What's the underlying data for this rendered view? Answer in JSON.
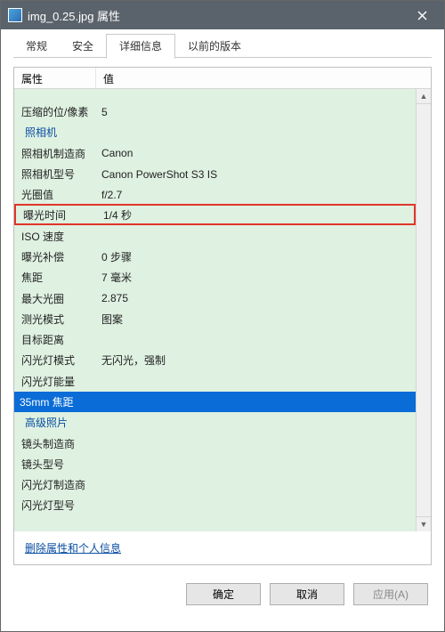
{
  "titlebar": {
    "title": "img_0.25.jpg 属性"
  },
  "tabs": [
    {
      "label": "常规"
    },
    {
      "label": "安全"
    },
    {
      "label": "详细信息",
      "active": true
    },
    {
      "label": "以前的版本"
    }
  ],
  "columns": {
    "property": "属性",
    "value": "值"
  },
  "rows": [
    {
      "type": "partial",
      "label": "",
      "value": ""
    },
    {
      "type": "data",
      "label": "压缩的位/像素",
      "value": "5"
    },
    {
      "type": "section",
      "label": "照相机",
      "value": ""
    },
    {
      "type": "data",
      "label": "照相机制造商",
      "value": "Canon"
    },
    {
      "type": "data",
      "label": "照相机型号",
      "value": "Canon PowerShot S3 IS"
    },
    {
      "type": "data",
      "label": "光圈值",
      "value": "f/2.7"
    },
    {
      "type": "hl-red",
      "label": "曝光时间",
      "value": "1/4 秒"
    },
    {
      "type": "data",
      "label": "ISO 速度",
      "value": ""
    },
    {
      "type": "data",
      "label": "曝光补偿",
      "value": "0 步骤"
    },
    {
      "type": "data",
      "label": "焦距",
      "value": "7 毫米"
    },
    {
      "type": "data",
      "label": "最大光圈",
      "value": "2.875"
    },
    {
      "type": "data",
      "label": "测光模式",
      "value": "图案"
    },
    {
      "type": "data",
      "label": "目标距离",
      "value": ""
    },
    {
      "type": "data",
      "label": "闪光灯模式",
      "value": "无闪光，强制"
    },
    {
      "type": "data",
      "label": "闪光灯能量",
      "value": ""
    },
    {
      "type": "selected",
      "label": "35mm 焦距",
      "value": ""
    },
    {
      "type": "section",
      "label": "高级照片",
      "value": ""
    },
    {
      "type": "data",
      "label": "镜头制造商",
      "value": ""
    },
    {
      "type": "data",
      "label": "镜头型号",
      "value": ""
    },
    {
      "type": "data",
      "label": "闪光灯制造商",
      "value": ""
    },
    {
      "type": "data",
      "label": "闪光灯型号",
      "value": ""
    }
  ],
  "link": "删除属性和个人信息",
  "buttons": {
    "ok": "确定",
    "cancel": "取消",
    "apply": "应用(A)"
  }
}
